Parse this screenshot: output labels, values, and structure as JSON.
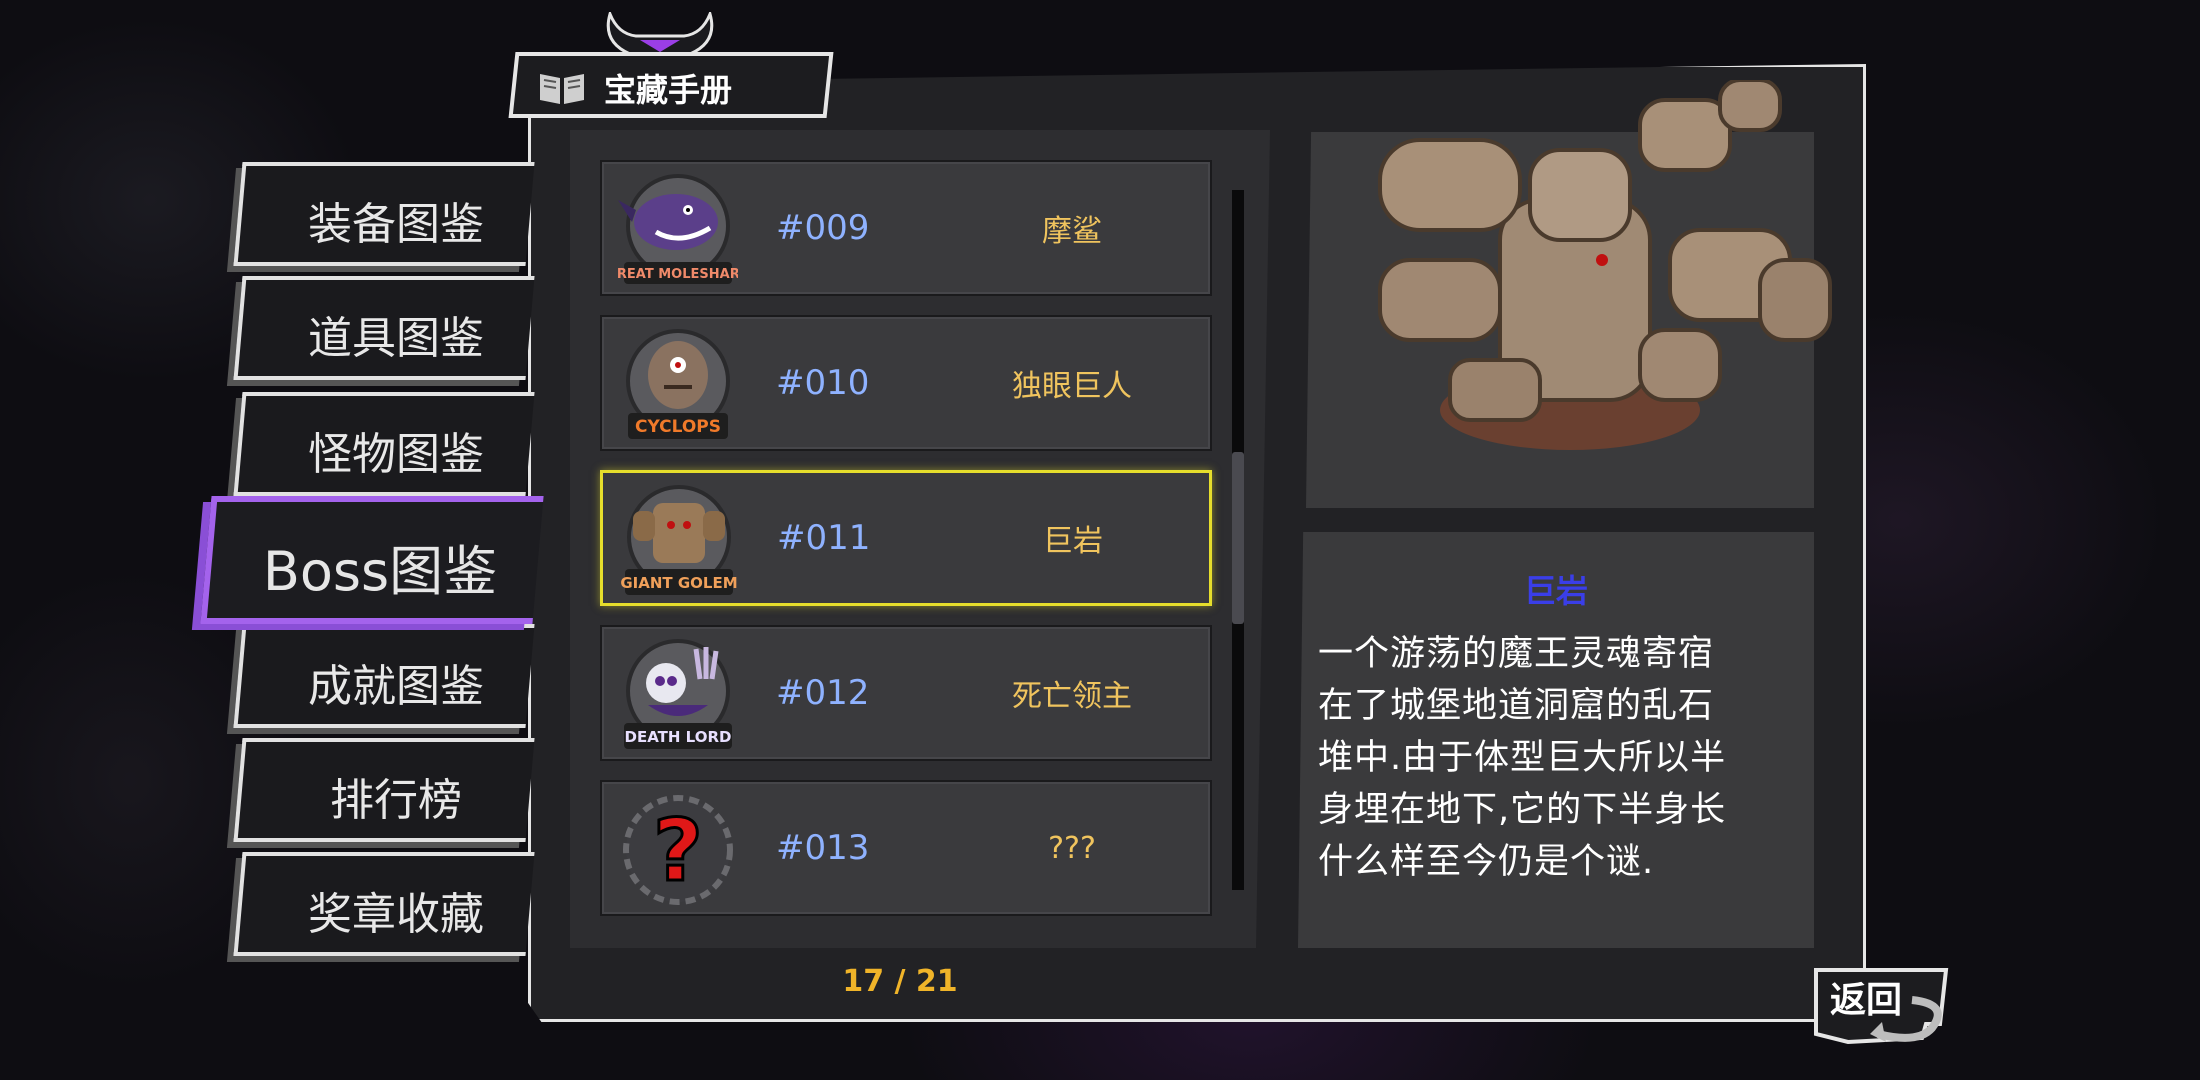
{
  "header": {
    "title": "宝藏手册",
    "icon": "book-icon"
  },
  "menu": {
    "items": [
      {
        "label": "装备图鉴",
        "active": false
      },
      {
        "label": "道具图鉴",
        "active": false
      },
      {
        "label": "怪物图鉴",
        "active": false
      },
      {
        "label": "Boss图鉴",
        "active": true
      },
      {
        "label": "成就图鉴",
        "active": false
      },
      {
        "label": "排行榜",
        "active": false
      },
      {
        "label": "奖章收藏",
        "active": false
      }
    ]
  },
  "list": {
    "rows": [
      {
        "num": "#009",
        "name": "摩鲨",
        "badge": "GREAT MOLESHARK",
        "portrait": "moleshark-portrait"
      },
      {
        "num": "#010",
        "name": "独眼巨人",
        "badge": "CYCLOPS",
        "portrait": "cyclops-portrait"
      },
      {
        "num": "#011",
        "name": "巨岩",
        "badge": "GIANT GOLEM",
        "portrait": "golem-portrait",
        "selected": true
      },
      {
        "num": "#012",
        "name": "死亡领主",
        "badge": "DEATH LORD",
        "portrait": "death-lord-portrait"
      },
      {
        "num": "#013",
        "name": "???",
        "badge": "",
        "portrait": "unknown-portrait"
      }
    ],
    "page": "17 / 21"
  },
  "detail": {
    "title": "巨岩",
    "description": "一个游荡的魔王灵魂寄宿在了城堡地道洞窟的乱石堆中.由于体型巨大所以半身埋在地下,它的下半身长什么样至今仍是个谜.",
    "description_lines": [
      "一个游荡的魔王灵魂寄宿",
      "在了城堡地道洞窟的乱石",
      "堆中.由于体型巨大所以半",
      "身埋在地下,它的下半身长",
      "什么样至今仍是个谜."
    ]
  },
  "back_button": {
    "label": "返回"
  },
  "colors": {
    "accent_purple": "#a463ec",
    "selected_yellow": "#e6de2c",
    "number_blue": "#8fb2ff",
    "name_gold": "#f0c45e",
    "title_blue": "#3a3ee8"
  }
}
